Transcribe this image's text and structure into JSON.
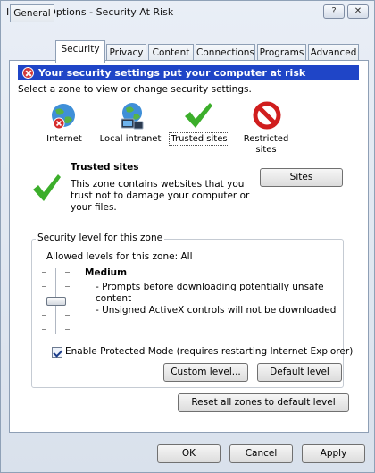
{
  "window": {
    "title": "Internet Options - Security At Risk",
    "help_glyph": "?",
    "close_glyph": "✕"
  },
  "tabs": [
    {
      "label": "General",
      "active": false
    },
    {
      "label": "Security",
      "active": true
    },
    {
      "label": "Privacy",
      "active": false
    },
    {
      "label": "Content",
      "active": false
    },
    {
      "label": "Connections",
      "active": false
    },
    {
      "label": "Programs",
      "active": false
    },
    {
      "label": "Advanced",
      "active": false
    }
  ],
  "security": {
    "warning": "Your security settings put your computer at risk",
    "select_prompt": "Select a zone to view or change security settings.",
    "zones": [
      {
        "label": "Internet",
        "icon": "globe-warning-icon"
      },
      {
        "label": "Local intranet",
        "icon": "network-globe-icon"
      },
      {
        "label": "Trusted sites",
        "icon": "green-check-icon",
        "selected": true
      },
      {
        "label": "Restricted sites",
        "icon": "no-entry-icon"
      }
    ],
    "zone_info": {
      "title": "Trusted sites",
      "description": "This zone contains websites that you trust not to damage your computer or your files.",
      "description_lines": [
        "This zone contains websites that you",
        "trust not to damage your computer or",
        "your files."
      ],
      "sites_button": "Sites"
    },
    "level_group": {
      "legend": "Security level for this zone",
      "allowed": "Allowed levels for this zone: All",
      "level_name": "Medium",
      "bullets": [
        "- Prompts before downloading potentially unsafe",
        "content",
        "- Unsigned ActiveX controls will not be downloaded"
      ],
      "protected_mode_label": "Enable Protected Mode (requires restarting Internet Explorer)",
      "protected_mode_checked": true,
      "custom_button": "Custom level...",
      "default_button": "Default level"
    },
    "reset_button": "Reset all zones to default level"
  },
  "footer": {
    "ok": "OK",
    "cancel": "Cancel",
    "apply": "Apply"
  },
  "colors": {
    "warning_bar": "#1f45c7",
    "check_green": "#3cae2b",
    "stop_red": "#d01e1e"
  }
}
